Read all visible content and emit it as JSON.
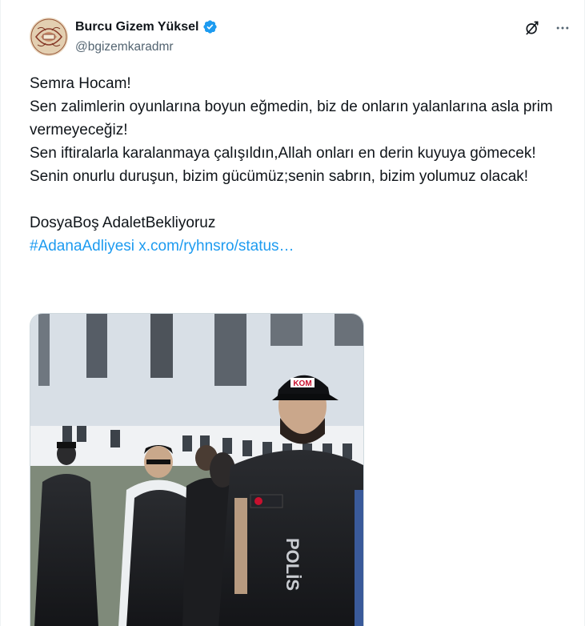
{
  "author": {
    "display_name": "Burcu Gizem Yüksel",
    "handle": "@bgizemkaradmr",
    "verified": true,
    "verified_color": "#1d9bf0",
    "avatar_icon": "ornamental-logo-avatar"
  },
  "toolbar": {
    "grok_icon": "grok-icon",
    "more_icon": "more-icon"
  },
  "post": {
    "lines": [
      "Semra Hocam!",
      "Sen zalimlerin oyunlarına boyun eğmedin, biz de onların yalanlarına asla prim vermeyeceğiz!",
      "Sen iftiralarla karalanmaya çalışıldın,Allah onları en derin kuyuya gömecek!",
      "Senin onurlu duruşun, bizim gücümüz;senin sabrın, bizim yolumuz olacak!"
    ],
    "tags_line": "DosyaBoş AdaletBekliyoruz",
    "hashtag": "#AdanaAdliyesi",
    "url": "x.com/ryhnsro/status…",
    "link_color": "#1d9bf0"
  },
  "media": {
    "vest_text": "POLİS",
    "cap_text": "KOM"
  }
}
